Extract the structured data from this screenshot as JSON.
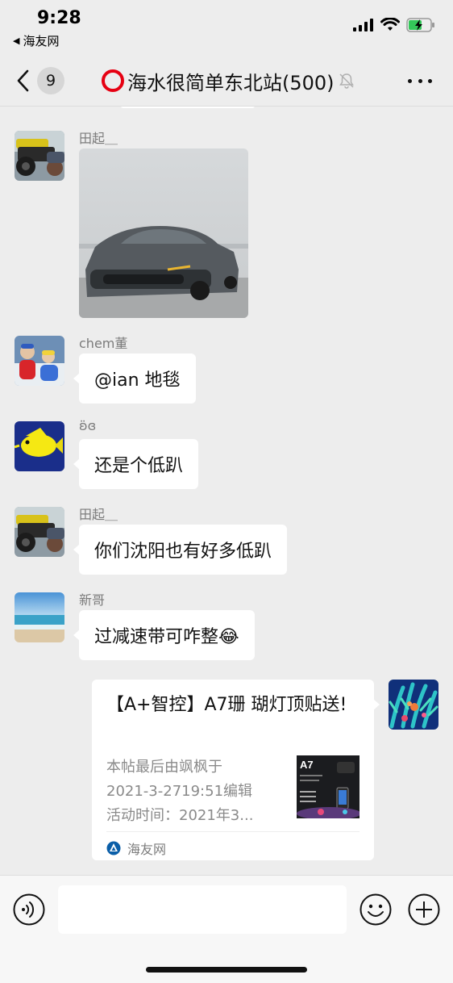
{
  "status_bar": {
    "time": "9:28",
    "back_app_label": "海友网",
    "icons": [
      "signal-icon",
      "wifi-icon",
      "battery-charging-icon"
    ]
  },
  "nav": {
    "unread_count": "9",
    "title": "海水很简单东北站(500)",
    "icons": [
      "back-chevron-icon",
      "red-ring-icon",
      "mute-bell-icon",
      "more-icon"
    ]
  },
  "messages": [
    {
      "sender": "田起＿",
      "type": "image",
      "image_desc": "gray-sedan-photo",
      "avatar": "atv-vehicle-avatar"
    },
    {
      "sender": "chem董",
      "type": "text",
      "text": "@ian 地毯",
      "avatar": "kids-snow-avatar"
    },
    {
      "sender": "ʚ̈ɞ",
      "type": "text",
      "text": "还是个低趴",
      "avatar": "yellow-tang-fish-avatar"
    },
    {
      "sender": "田起＿",
      "type": "text",
      "text": "你们沈阳也有好多低趴",
      "avatar": "atv-vehicle-avatar"
    },
    {
      "sender": "新哥",
      "type": "text",
      "text": "过减速带可咋整😂",
      "avatar": "beach-avatar"
    }
  ],
  "link_card": {
    "title": "【A+智控】A7珊 瑚灯顶贴送!",
    "desc_lines": [
      "本帖最后由飒枫于",
      "2021-3-2719:51编辑",
      "活动时间：2021年3..."
    ],
    "thumb_label": "A7",
    "source": "海友网",
    "avatar": "coral-avatar"
  },
  "input_bar": {
    "placeholder": "",
    "icons": [
      "voice-icon",
      "emoji-icon",
      "plus-icon"
    ]
  },
  "colors": {
    "background": "#ededed",
    "bubble": "#ffffff",
    "sender_text": "#7b7b7b",
    "accent_red": "#e60012"
  }
}
